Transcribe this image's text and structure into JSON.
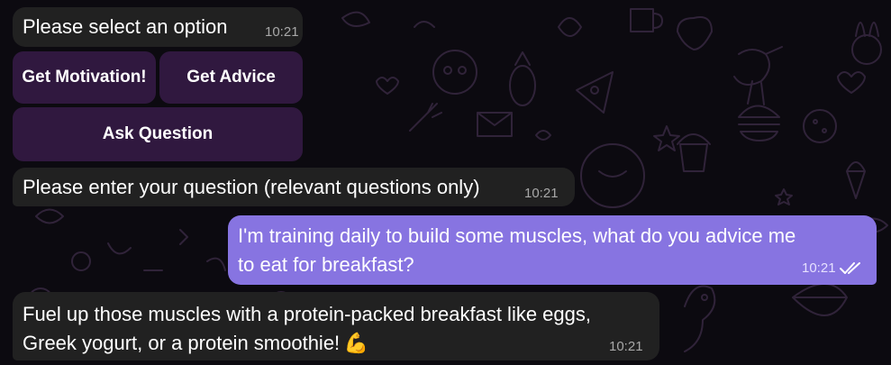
{
  "chat": {
    "messages": [
      {
        "text": "Please select an option",
        "time": "10:21",
        "direction": "incoming"
      },
      {
        "text": "Please enter your question (relevant questions only)",
        "time": "10:21",
        "direction": "incoming"
      },
      {
        "text_line1": "I'm training daily to build some muscles, what do you advice me",
        "text_line2": "to eat for breakfast?",
        "time": "10:21",
        "direction": "outgoing",
        "status": "read"
      },
      {
        "text_line1": "Fuel up those muscles with a protein-packed breakfast like eggs,",
        "text_line2": "Greek yogurt, or a protein smoothie!",
        "emoji": "💪",
        "time": "10:21",
        "direction": "incoming"
      }
    ],
    "keyboard": {
      "buttons": [
        "Get Motivation!",
        "Get Advice",
        "Ask Question"
      ]
    }
  },
  "colors": {
    "background": "#0c0a10",
    "incoming_bubble": "#212121",
    "outgoing_bubble": "#8774e1",
    "keyboard_button": "#3a1f4d",
    "wallpaper_doodles": "#3a2a44"
  },
  "icons": {
    "read_status": "double-check-icon",
    "wallpaper": "doodle-pattern"
  }
}
